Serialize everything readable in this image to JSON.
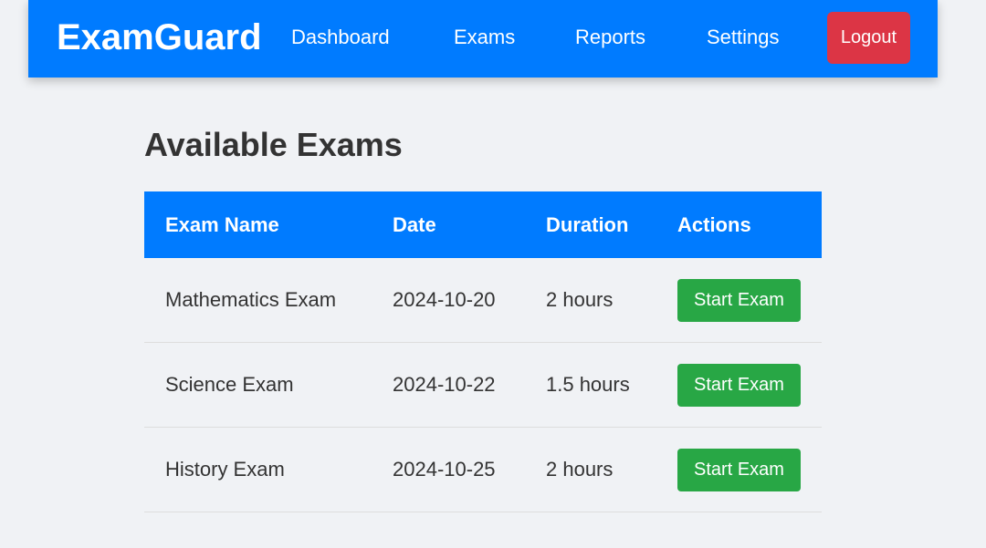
{
  "navbar": {
    "brand": "ExamGuard",
    "links": [
      "Dashboard",
      "Exams",
      "Reports",
      "Settings"
    ],
    "logout_label": "Logout",
    "colors": {
      "primary": "#007bff",
      "danger": "#dc3545"
    }
  },
  "main": {
    "title": "Available Exams",
    "table": {
      "headers": [
        "Exam Name",
        "Date",
        "Duration",
        "Actions"
      ],
      "rows": [
        {
          "name": "Mathematics Exam",
          "date": "2024-10-20",
          "duration": "2 hours",
          "action": "Start Exam"
        },
        {
          "name": "Science Exam",
          "date": "2024-10-22",
          "duration": "1.5 hours",
          "action": "Start Exam"
        },
        {
          "name": "History Exam",
          "date": "2024-10-25",
          "duration": "2 hours",
          "action": "Start Exam"
        }
      ],
      "action_color": "#28a745"
    }
  }
}
